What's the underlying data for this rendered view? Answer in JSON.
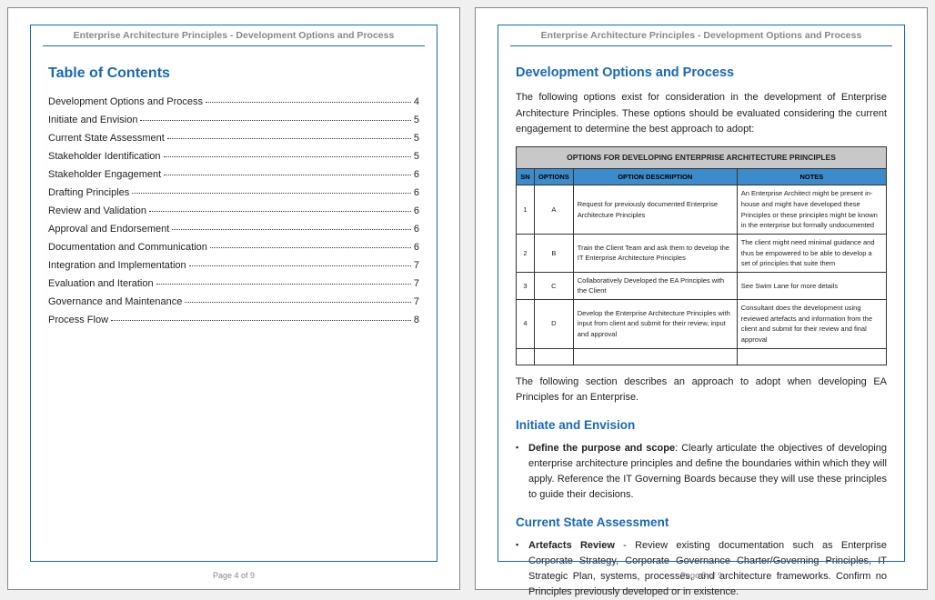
{
  "header": "Enterprise Architecture Principles - Development Options and Process",
  "leftPage": {
    "tocTitle": "Table of Contents",
    "tocItems": [
      {
        "label": "Development Options and Process",
        "page": "4"
      },
      {
        "label": "Initiate and Envision",
        "page": "5"
      },
      {
        "label": "Current State Assessment",
        "page": "5"
      },
      {
        "label": "Stakeholder Identification",
        "page": "5"
      },
      {
        "label": "Stakeholder Engagement",
        "page": "6"
      },
      {
        "label": "Drafting Principles",
        "page": "6"
      },
      {
        "label": "Review and Validation",
        "page": "6"
      },
      {
        "label": "Approval and Endorsement",
        "page": "6"
      },
      {
        "label": "Documentation and Communication",
        "page": "6"
      },
      {
        "label": "Integration and Implementation",
        "page": "7"
      },
      {
        "label": "Evaluation and Iteration",
        "page": "7"
      },
      {
        "label": "Governance and Maintenance",
        "page": "7"
      },
      {
        "label": "Process Flow",
        "page": "8"
      }
    ],
    "footer": "Page 4 of 9"
  },
  "rightPage": {
    "title": "Development Options and Process",
    "introPara": "The following options exist for consideration in the development of Enterprise Architecture Principles. These options should be evaluated considering the current engagement to determine the best approach to adopt:",
    "tableCaption": "OPTIONS FOR DEVELOPING ENTERPRISE ARCHITECTURE PRINCIPLES",
    "tableHeaders": {
      "sn": "SN",
      "options": "OPTIONS",
      "desc": "OPTION DESCRIPTION",
      "notes": "NOTES"
    },
    "tableRows": [
      {
        "sn": "1",
        "opt": "A",
        "desc": "Request for previously documented Enterprise Architecture Principles",
        "notes": "An Enterprise Architect might be present in-house and might have developed these Principles or these principles might be known in the enterprise but formally undocumented"
      },
      {
        "sn": "2",
        "opt": "B",
        "desc": "Train the Client Team and ask them to develop the IT Enterprise Architecture Principles",
        "notes": "The client might need minimal guidance and thus be empowered to be able to develop a set of principles that suite them"
      },
      {
        "sn": "3",
        "opt": "C",
        "desc": "Collaboratively Developed the EA Principles with the Client",
        "notes": "See Swim Lane for more details"
      },
      {
        "sn": "4",
        "opt": "D",
        "desc": "Develop the Enterprise Architecture Principles with input from client and submit for their review, input and approval",
        "notes": "Consultant does the development using reviewed artefacts and information from the client and submit for their review and final approval"
      }
    ],
    "afterTablePara": "The following section describes an approach to adopt when developing EA Principles for an Enterprise.",
    "section2Title": "Initiate and Envision",
    "bullet2Lead": "Define the purpose and scope",
    "bullet2Rest": ": Clearly articulate the objectives of developing enterprise architecture principles and define the boundaries within which they will apply. Reference the IT Governing Boards because they will use these principles to guide their decisions.",
    "section3Title": "Current State Assessment",
    "bullet3Lead": "Artefacts Review",
    "bullet3Rest": " - Review existing documentation such as Enterprise Corporate Strategy, Corporate Governance Charter/Governing Principles, IT Strategic Plan, systems, processes, and architecture frameworks. Confirm no Principles previously developed or in existence.",
    "footer": "Page 5 of 9"
  }
}
